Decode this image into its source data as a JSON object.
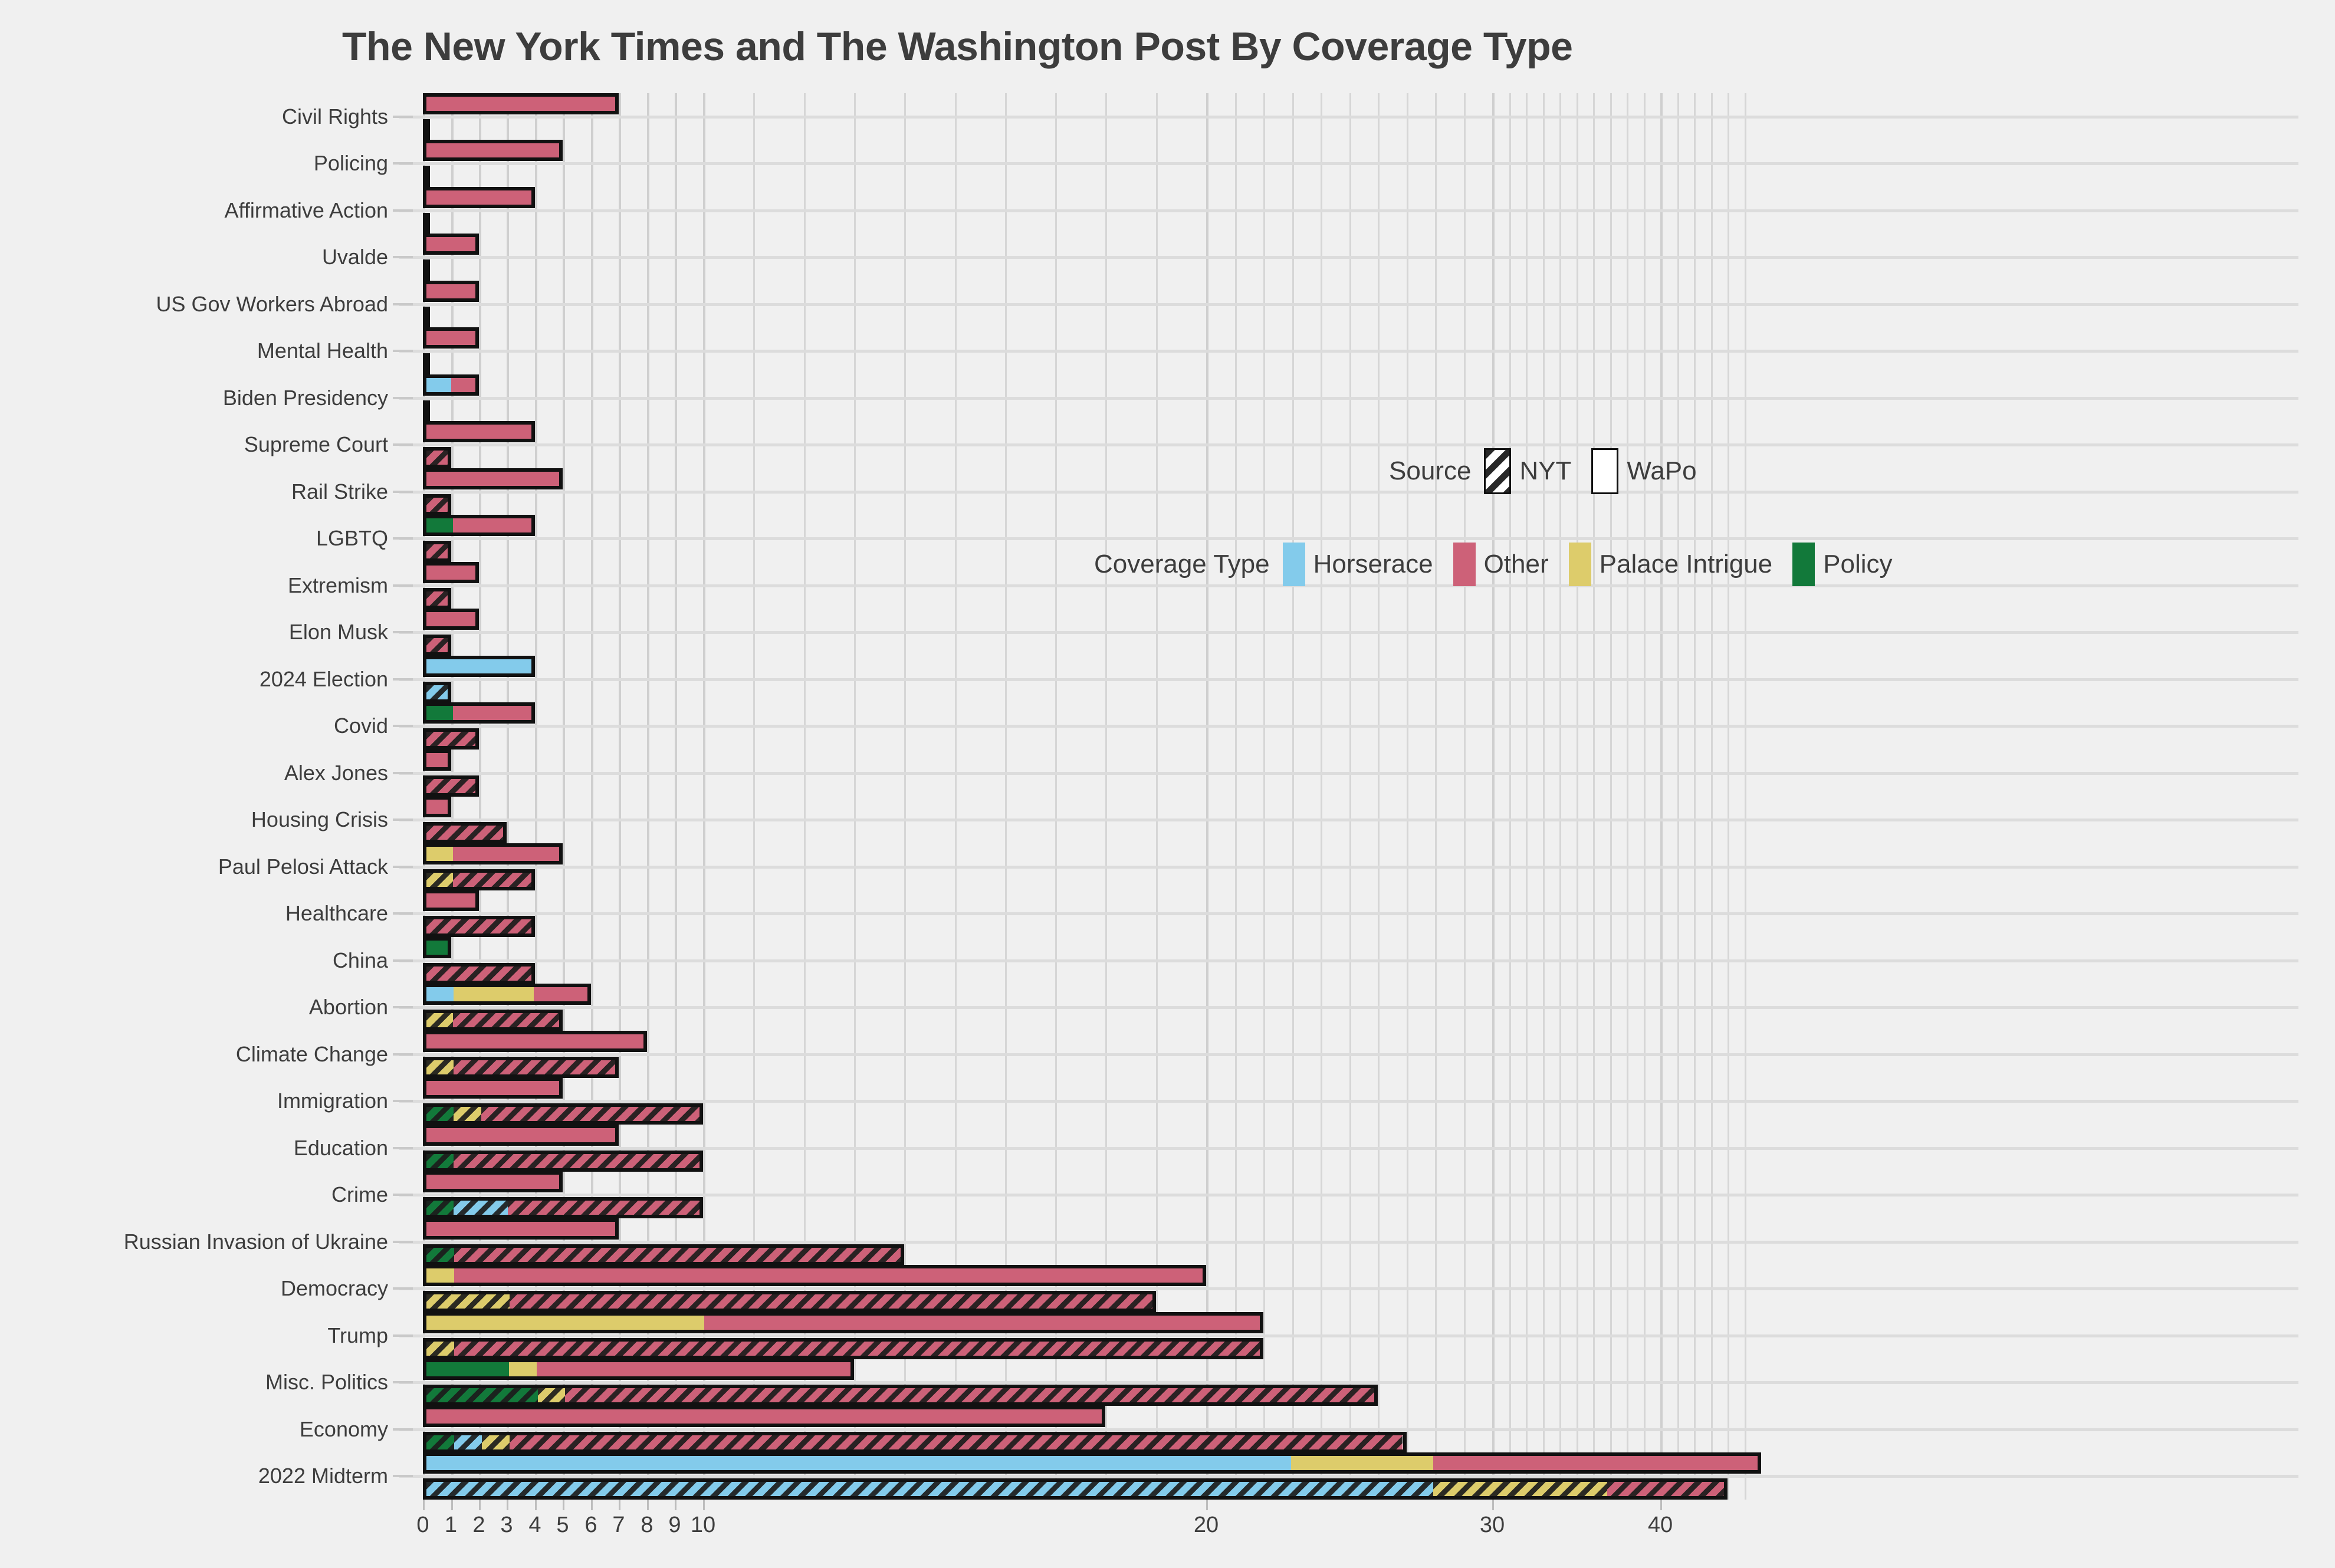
{
  "title": "The New York Times and The Washington Post By Coverage Type",
  "legends": {
    "source": {
      "title": "Source",
      "entries": [
        {
          "label": "NYT",
          "pattern": "hatched"
        },
        {
          "label": "WaPo",
          "pattern": "solid"
        }
      ]
    },
    "coverage": {
      "title": "Coverage Type",
      "entries": [
        {
          "label": "Horserace",
          "color": "#83cbeb"
        },
        {
          "label": "Other",
          "color": "#cd6178"
        },
        {
          "label": "Palace Intrigue",
          "color": "#ddcc6b"
        },
        {
          "label": "Policy",
          "color": "#12793a"
        }
      ]
    }
  },
  "colors": {
    "horserace": "#83cbeb",
    "other": "#cd6178",
    "palace_intrigue": "#ddcc6b",
    "policy": "#12793a",
    "background": "#f0f0f0",
    "text": "#3d3d3d",
    "grid": "#d6d6d6",
    "bar_outline": "#111111"
  },
  "chart_data": {
    "type": "bar",
    "orientation": "horizontal",
    "stacked": true,
    "grouped_by": "source",
    "title": "The New York Times and The Washington Post By Coverage Type",
    "xlabel": "",
    "ylabel": "",
    "xlim": [
      0,
      46
    ],
    "xticks": [
      0,
      1,
      2,
      3,
      4,
      5,
      6,
      7,
      8,
      9,
      10,
      20,
      30,
      40
    ],
    "xtick_labels": [
      "0",
      "1",
      "2",
      "3",
      "4",
      "5",
      "6",
      "7",
      "8",
      "9",
      "10",
      "20",
      "30",
      "40"
    ],
    "x_scale": "non-linear (compressed above 10)",
    "grid": true,
    "legend_position": "inside-right",
    "series": [
      "Horserace",
      "Other",
      "Palace Intrigue",
      "Policy"
    ],
    "sources": [
      "WaPo",
      "NYT"
    ],
    "categories": [
      "Civil Rights",
      "Policing",
      "Affirmative Action",
      "Uvalde",
      "US Gov Workers Abroad",
      "Mental Health",
      "Biden Presidency",
      "Supreme Court",
      "Rail Strike",
      "LGBTQ",
      "Extremism",
      "Elon Musk",
      "2024 Election",
      "Covid",
      "Alex Jones",
      "Housing Crisis",
      "Paul Pelosi Attack",
      "Healthcare",
      "China",
      "Abortion",
      "Climate Change",
      "Immigration",
      "Education",
      "Crime",
      "Russian Invasion of Ukraine",
      "Democracy",
      "Trump",
      "Misc. Politics",
      "Economy",
      "2022 Midterm"
    ],
    "rows": [
      {
        "category": "Civil Rights",
        "wapo": {
          "policy": 0,
          "horserace": 0,
          "palace": 0,
          "other": 7
        },
        "nyt": {
          "policy": 0,
          "horserace": 0,
          "palace": 0,
          "other": 0
        }
      },
      {
        "category": "Policing",
        "wapo": {
          "policy": 0,
          "horserace": 0,
          "palace": 0,
          "other": 5
        },
        "nyt": {
          "policy": 0,
          "horserace": 0,
          "palace": 0,
          "other": 0
        }
      },
      {
        "category": "Affirmative Action",
        "wapo": {
          "policy": 0,
          "horserace": 0,
          "palace": 0,
          "other": 4
        },
        "nyt": {
          "policy": 0,
          "horserace": 0,
          "palace": 0,
          "other": 0
        }
      },
      {
        "category": "Uvalde",
        "wapo": {
          "policy": 0,
          "horserace": 0,
          "palace": 0,
          "other": 2
        },
        "nyt": {
          "policy": 0,
          "horserace": 0,
          "palace": 0,
          "other": 0
        }
      },
      {
        "category": "US Gov Workers Abroad",
        "wapo": {
          "policy": 0,
          "horserace": 0,
          "palace": 0,
          "other": 2
        },
        "nyt": {
          "policy": 0,
          "horserace": 0,
          "palace": 0,
          "other": 0
        }
      },
      {
        "category": "Mental Health",
        "wapo": {
          "policy": 0,
          "horserace": 0,
          "palace": 0,
          "other": 2
        },
        "nyt": {
          "policy": 0,
          "horserace": 0,
          "palace": 0,
          "other": 0
        }
      },
      {
        "category": "Biden Presidency",
        "wapo": {
          "policy": 0,
          "horserace": 1,
          "palace": 0,
          "other": 1
        },
        "nyt": {
          "policy": 0,
          "horserace": 0,
          "palace": 0,
          "other": 0
        }
      },
      {
        "category": "Supreme Court",
        "wapo": {
          "policy": 0,
          "horserace": 0,
          "palace": 0,
          "other": 4
        },
        "nyt": {
          "policy": 0,
          "horserace": 0,
          "palace": 0,
          "other": 1
        }
      },
      {
        "category": "Rail Strike",
        "wapo": {
          "policy": 0,
          "horserace": 0,
          "palace": 0,
          "other": 5
        },
        "nyt": {
          "policy": 0,
          "horserace": 0,
          "palace": 0,
          "other": 1
        }
      },
      {
        "category": "LGBTQ",
        "wapo": {
          "policy": 1,
          "horserace": 0,
          "palace": 0,
          "other": 3
        },
        "nyt": {
          "policy": 0,
          "horserace": 0,
          "palace": 0,
          "other": 1
        }
      },
      {
        "category": "Extremism",
        "wapo": {
          "policy": 0,
          "horserace": 0,
          "palace": 0,
          "other": 2
        },
        "nyt": {
          "policy": 0,
          "horserace": 0,
          "palace": 0,
          "other": 1
        }
      },
      {
        "category": "Elon Musk",
        "wapo": {
          "policy": 0,
          "horserace": 0,
          "palace": 0,
          "other": 2
        },
        "nyt": {
          "policy": 0,
          "horserace": 0,
          "palace": 0,
          "other": 1
        }
      },
      {
        "category": "2024 Election",
        "wapo": {
          "policy": 0,
          "horserace": 4,
          "palace": 0,
          "other": 0
        },
        "nyt": {
          "policy": 0,
          "horserace": 1,
          "palace": 0,
          "other": 0
        }
      },
      {
        "category": "Covid",
        "wapo": {
          "policy": 1,
          "horserace": 0,
          "palace": 0,
          "other": 3
        },
        "nyt": {
          "policy": 0,
          "horserace": 0,
          "palace": 0,
          "other": 2
        }
      },
      {
        "category": "Alex Jones",
        "wapo": {
          "policy": 0,
          "horserace": 0,
          "palace": 0,
          "other": 1
        },
        "nyt": {
          "policy": 0,
          "horserace": 0,
          "palace": 0,
          "other": 2
        }
      },
      {
        "category": "Housing Crisis",
        "wapo": {
          "policy": 0,
          "horserace": 0,
          "palace": 0,
          "other": 1
        },
        "nyt": {
          "policy": 0,
          "horserace": 0,
          "palace": 0,
          "other": 3
        }
      },
      {
        "category": "Paul Pelosi Attack",
        "wapo": {
          "policy": 0,
          "horserace": 0,
          "palace": 1,
          "other": 4
        },
        "nyt": {
          "policy": 0,
          "horserace": 0,
          "palace": 1,
          "other": 3
        }
      },
      {
        "category": "Healthcare",
        "wapo": {
          "policy": 0,
          "horserace": 0,
          "palace": 0,
          "other": 2
        },
        "nyt": {
          "policy": 0,
          "horserace": 0,
          "palace": 0,
          "other": 4
        }
      },
      {
        "category": "China",
        "wapo": {
          "policy": 1,
          "horserace": 0,
          "palace": 0,
          "other": 0
        },
        "nyt": {
          "policy": 0,
          "horserace": 0,
          "palace": 0,
          "other": 4
        }
      },
      {
        "category": "Abortion",
        "wapo": {
          "policy": 0,
          "horserace": 1,
          "palace": 3,
          "other": 2
        },
        "nyt": {
          "policy": 0,
          "horserace": 0,
          "palace": 1,
          "other": 4
        }
      },
      {
        "category": "Climate Change",
        "wapo": {
          "policy": 0,
          "horserace": 0,
          "palace": 0,
          "other": 8
        },
        "nyt": {
          "policy": 0,
          "horserace": 0,
          "palace": 1,
          "other": 6
        }
      },
      {
        "category": "Immigration",
        "wapo": {
          "policy": 0,
          "horserace": 0,
          "palace": 0,
          "other": 5
        },
        "nyt": {
          "policy": 1,
          "horserace": 0,
          "palace": 1,
          "other": 8
        }
      },
      {
        "category": "Education",
        "wapo": {
          "policy": 0,
          "horserace": 0,
          "palace": 0,
          "other": 7
        },
        "nyt": {
          "policy": 1,
          "horserace": 0,
          "palace": 0,
          "other": 9
        }
      },
      {
        "category": "Crime",
        "wapo": {
          "policy": 0,
          "horserace": 0,
          "palace": 0,
          "other": 5
        },
        "nyt": {
          "policy": 1,
          "horserace": 2,
          "palace": 0,
          "other": 7
        }
      },
      {
        "category": "Russian Invasion of Ukraine",
        "wapo": {
          "policy": 0,
          "horserace": 0,
          "palace": 0,
          "other": 7
        },
        "nyt": {
          "policy": 1,
          "horserace": 0,
          "palace": 0,
          "other": 13
        }
      },
      {
        "category": "Democracy",
        "wapo": {
          "policy": 0,
          "horserace": 0,
          "palace": 1,
          "other": 19
        },
        "nyt": {
          "policy": 0,
          "horserace": 0,
          "palace": 3,
          "other": 16
        }
      },
      {
        "category": "Trump",
        "wapo": {
          "policy": 0,
          "horserace": 0,
          "palace": 10,
          "other": 12
        },
        "nyt": {
          "policy": 0,
          "horserace": 0,
          "palace": 1,
          "other": 21
        }
      },
      {
        "category": "Misc. Politics",
        "wapo": {
          "policy": 3,
          "horserace": 0,
          "palace": 1,
          "other": 9
        },
        "nyt": {
          "policy": 4,
          "horserace": 0,
          "palace": 1,
          "other": 21
        }
      },
      {
        "category": "Economy",
        "wapo": {
          "policy": 0,
          "horserace": 0,
          "palace": 0,
          "other": 18
        },
        "nyt": {
          "policy": 1,
          "horserace": 1,
          "palace": 1,
          "other": 24
        }
      },
      {
        "category": "2022 Midterm",
        "wapo": {
          "policy": 0,
          "horserace": 23,
          "palace": 5,
          "other": 18
        },
        "nyt": {
          "policy": 0,
          "horserace": 28,
          "palace": 9,
          "other": 7
        }
      }
    ]
  }
}
